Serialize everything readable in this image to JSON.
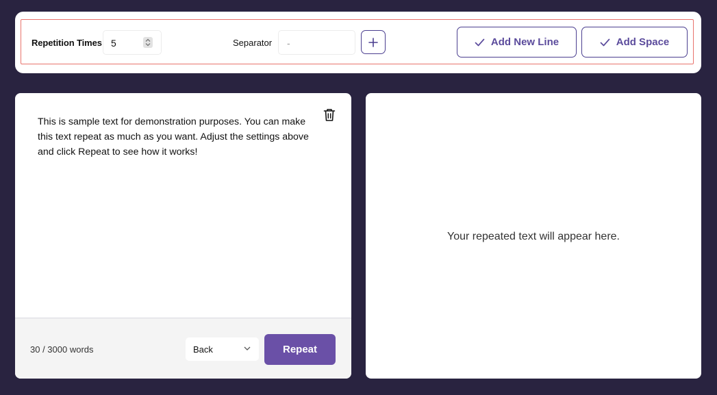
{
  "toolbar": {
    "repetition_label": "Repetition Times",
    "repetition_value": "5",
    "separator_label": "Separator",
    "separator_placeholder": "-",
    "add_new_line_label": "Add New Line",
    "add_space_label": "Add Space"
  },
  "editor": {
    "text": "This is sample text for demonstration purposes. You can make this text repeat as much as you want. Adjust the settings above and click Repeat to see how it works!",
    "word_count": "30 / 3000 words",
    "mode_select_value": "Back",
    "repeat_label": "Repeat"
  },
  "output": {
    "placeholder": "Your repeated text will appear here."
  },
  "colors": {
    "background": "#292340",
    "accent": "#6a50a7",
    "border_accent": "#4a3e8f",
    "highlight": "#e8726b"
  },
  "icons": [
    "check-icon",
    "plus-icon",
    "trash-icon",
    "chevron-down-icon",
    "spinner-icon"
  ]
}
